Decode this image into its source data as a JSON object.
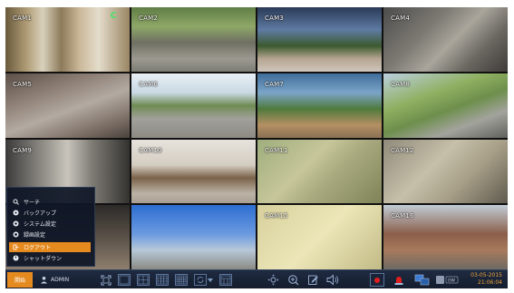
{
  "cameras": [
    {
      "label": "CAM1"
    },
    {
      "label": "CAM2"
    },
    {
      "label": "CAM3"
    },
    {
      "label": "CAM4"
    },
    {
      "label": "CAM5"
    },
    {
      "label": "CAM6"
    },
    {
      "label": "CAM7"
    },
    {
      "label": "CAM8"
    },
    {
      "label": "CAM9"
    },
    {
      "label": "CAM10"
    },
    {
      "label": "CAM11"
    },
    {
      "label": "CAM12"
    },
    {
      "label": ""
    },
    {
      "label": ""
    },
    {
      "label": "CAM15"
    },
    {
      "label": "CAM16"
    }
  ],
  "cam1_badge": "C",
  "menu": {
    "items": [
      {
        "label": "サーチ",
        "icon": "search-icon"
      },
      {
        "label": "バックアップ",
        "icon": "backup-icon"
      },
      {
        "label": "システム設定",
        "icon": "settings-icon"
      },
      {
        "label": "録画設定",
        "icon": "record-settings-icon"
      },
      {
        "label": "ログアウト",
        "icon": "logout-icon",
        "active": true
      },
      {
        "label": "シャットダウン",
        "icon": "power-icon"
      }
    ]
  },
  "toolbar": {
    "start_label": "開始",
    "user_name": "ADMIN",
    "date": "03-05-2015",
    "time": "21:06:04"
  },
  "colors": {
    "accent": "#e58a1f",
    "datetime": "#f0a33a",
    "toolbar_bg": "#141c2c"
  }
}
